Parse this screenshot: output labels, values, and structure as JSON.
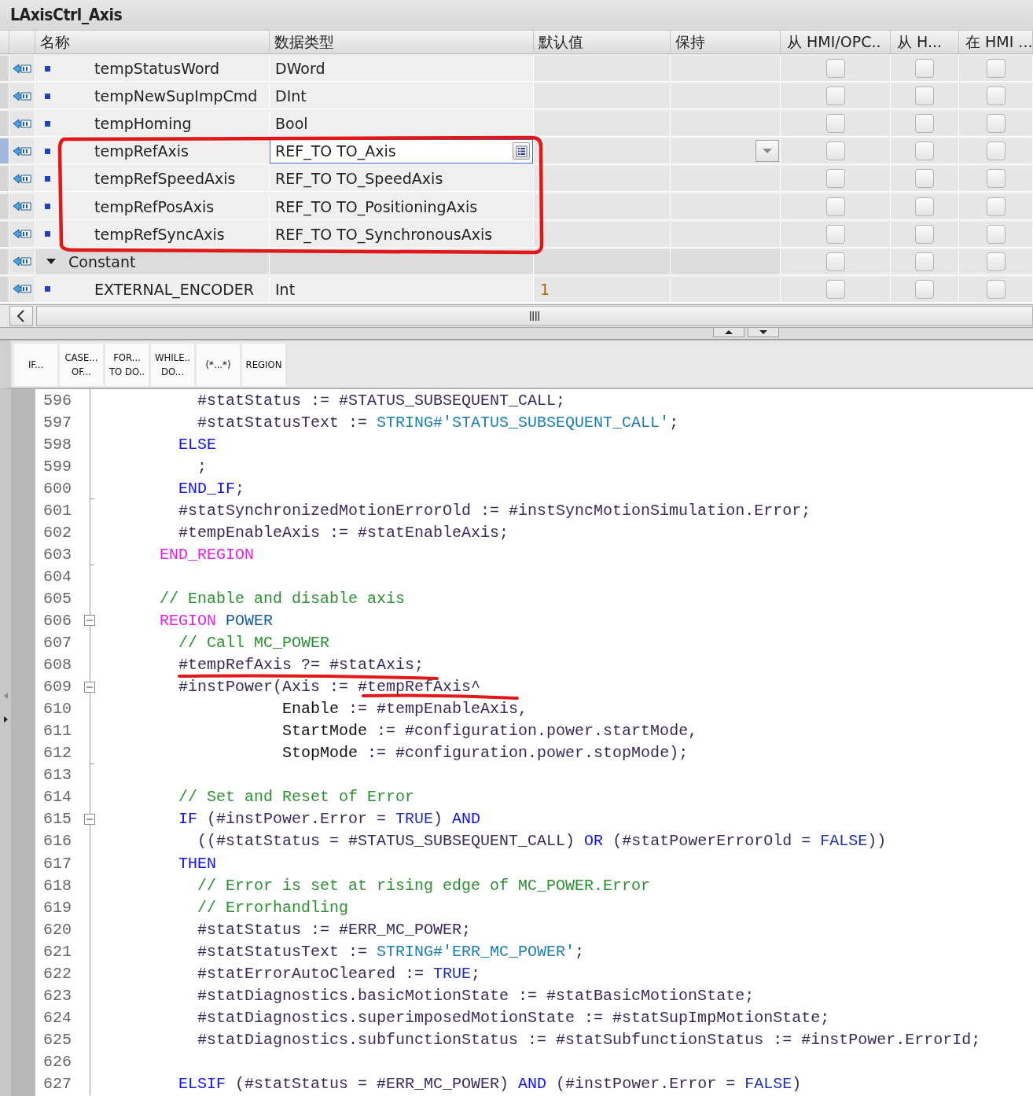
{
  "window": {
    "title": "LAxisCtrl_Axis"
  },
  "table": {
    "columns": [
      "名称",
      "数据类型",
      "默认值",
      "保持",
      "从 HMI/OPC..",
      "从 H...",
      "在 HMI ..."
    ],
    "rows": [
      {
        "kind": "variable",
        "name": "tempStatusWord",
        "type": "DWord",
        "selected": false,
        "checks": [
          false,
          false,
          false
        ]
      },
      {
        "kind": "variable",
        "name": "tempNewSupImpCmd",
        "type": "DInt",
        "selected": false,
        "checks": [
          false,
          false,
          false
        ]
      },
      {
        "kind": "variable",
        "name": "tempHoming",
        "type": "Bool",
        "selected": false,
        "checks": [
          false,
          false,
          false
        ]
      },
      {
        "kind": "variable",
        "name": "tempRefAxis",
        "type": "REF_TO TO_Axis",
        "selected": true,
        "checks": [
          false,
          false,
          false
        ]
      },
      {
        "kind": "variable",
        "name": "tempRefSpeedAxis",
        "type": "REF_TO TO_SpeedAxis",
        "selected": false,
        "checks": [
          false,
          false,
          false
        ]
      },
      {
        "kind": "variable",
        "name": "tempRefPosAxis",
        "type": "REF_TO TO_PositioningAxis",
        "selected": false,
        "checks": [
          false,
          false,
          false
        ]
      },
      {
        "kind": "variable",
        "name": "tempRefSyncAxis",
        "type": "REF_TO TO_SynchronousAxis",
        "selected": false,
        "checks": [
          false,
          false,
          false
        ]
      },
      {
        "kind": "section",
        "name": "Constant",
        "expanded": true,
        "selected": false,
        "checks": [
          false,
          false,
          false
        ],
        "children": [
          {
            "kind": "variable",
            "name": "EXTERNAL_ENCODER",
            "type": "Int",
            "default": "1",
            "selected": false,
            "checks": [
              false,
              false,
              false
            ]
          }
        ]
      }
    ]
  },
  "toolbar": [
    "IF...",
    "CASE...\nOF...",
    "FOR...\nTO DO..",
    "WHILE..\nDO...",
    "(*...*)",
    "REGION"
  ],
  "code": [
    {
      "n": "596",
      "tokens": [
        {
          "kind": "var",
          "text": "          #statStatus := #STATUS_SUBSEQUENT_CALL;"
        }
      ]
    },
    {
      "n": "597",
      "tokens": [
        {
          "kind": "var",
          "text": "          #statStatusText := "
        },
        {
          "kind": "string",
          "text": "STRING#'STATUS_SUBSEQUENT_CALL'"
        },
        {
          "kind": "var",
          "text": ";"
        }
      ]
    },
    {
      "n": "598",
      "tokens": [
        {
          "kind": "keyword",
          "text": "        ELSE"
        }
      ]
    },
    {
      "n": "599",
      "tokens": [
        {
          "kind": "var",
          "text": "          ;"
        }
      ]
    },
    {
      "n": "600",
      "fold_end": true,
      "tokens": [
        {
          "kind": "keyword",
          "text": "        END_IF"
        },
        {
          "kind": "var",
          "text": ";"
        }
      ]
    },
    {
      "n": "601",
      "tokens": [
        {
          "kind": "var",
          "text": "        #statSynchronizedMotionErrorOld := #instSyncMotionSimulation.Error;"
        }
      ]
    },
    {
      "n": "602",
      "tokens": [
        {
          "kind": "var",
          "text": "        #tempEnableAxis := #statEnableAxis;"
        }
      ]
    },
    {
      "n": "603",
      "fold_end": true,
      "tokens": [
        {
          "kind": "region",
          "text": "      END_REGION"
        }
      ]
    },
    {
      "n": "604"
    },
    {
      "n": "605",
      "tokens": [
        {
          "kind": "comment",
          "text": "      // Enable and disable axis"
        }
      ]
    },
    {
      "n": "606",
      "fold": true,
      "tokens": [
        {
          "kind": "region",
          "text": "      REGION"
        },
        {
          "kind": "name",
          "text": " POWER"
        }
      ]
    },
    {
      "n": "607",
      "tokens": [
        {
          "kind": "comment",
          "text": "        // Call MC_POWER"
        }
      ]
    },
    {
      "n": "608",
      "tokens": [
        {
          "kind": "var",
          "text": "        #tempRefAxis ?= #statAxis;"
        }
      ]
    },
    {
      "n": "609",
      "fold": true,
      "tokens": [
        {
          "kind": "var",
          "text": "        #instPower(Axis := #tempRefAxis^"
        }
      ]
    },
    {
      "n": "610",
      "tokens": [
        {
          "kind": "plain",
          "text": "                   Enable"
        },
        {
          "kind": "var",
          "text": " := #tempEnableAxis,"
        }
      ]
    },
    {
      "n": "611",
      "tokens": [
        {
          "kind": "plain",
          "text": "                   StartMode"
        },
        {
          "kind": "var",
          "text": " := #configuration.power.startMode,"
        }
      ]
    },
    {
      "n": "612",
      "fold_end": true,
      "tokens": [
        {
          "kind": "plain",
          "text": "                   StopMode"
        },
        {
          "kind": "var",
          "text": " := #configuration.power.stopMode);"
        }
      ]
    },
    {
      "n": "613"
    },
    {
      "n": "614",
      "tokens": [
        {
          "kind": "comment",
          "text": "        // Set and Reset of Error"
        }
      ]
    },
    {
      "n": "615",
      "fold": true,
      "tokens": [
        {
          "kind": "keyword",
          "text": "        IF"
        },
        {
          "kind": "var",
          "text": " (#instPower.Error = "
        },
        {
          "kind": "const",
          "text": "TRUE"
        },
        {
          "kind": "var",
          "text": ") "
        },
        {
          "kind": "keyword",
          "text": "AND"
        }
      ]
    },
    {
      "n": "616",
      "tokens": [
        {
          "kind": "var",
          "text": "          ((#statStatus = #STATUS_SUBSEQUENT_CALL) "
        },
        {
          "kind": "keyword",
          "text": "OR"
        },
        {
          "kind": "var",
          "text": " (#statPowerErrorOld = "
        },
        {
          "kind": "const",
          "text": "FALSE"
        },
        {
          "kind": "var",
          "text": "))"
        }
      ]
    },
    {
      "n": "617",
      "tokens": [
        {
          "kind": "keyword",
          "text": "        THEN"
        }
      ]
    },
    {
      "n": "618",
      "tokens": [
        {
          "kind": "comment",
          "text": "          // Error is set at rising edge of MC_POWER.Error"
        }
      ]
    },
    {
      "n": "619",
      "tokens": [
        {
          "kind": "comment",
          "text": "          // Errorhandling"
        }
      ]
    },
    {
      "n": "620",
      "tokens": [
        {
          "kind": "var",
          "text": "          #statStatus := #ERR_MC_POWER;"
        }
      ]
    },
    {
      "n": "621",
      "tokens": [
        {
          "kind": "var",
          "text": "          #statStatusText := "
        },
        {
          "kind": "string",
          "text": "STRING#'ERR_MC_POWER'"
        },
        {
          "kind": "var",
          "text": ";"
        }
      ]
    },
    {
      "n": "622",
      "tokens": [
        {
          "kind": "var",
          "text": "          #statErrorAutoCleared := "
        },
        {
          "kind": "const",
          "text": "TRUE"
        },
        {
          "kind": "var",
          "text": ";"
        }
      ]
    },
    {
      "n": "623",
      "tokens": [
        {
          "kind": "var",
          "text": "          #statDiagnostics.basicMotionState := #statBasicMotionState;"
        }
      ]
    },
    {
      "n": "624",
      "tokens": [
        {
          "kind": "var",
          "text": "          #statDiagnostics.superimposedMotionState := #statSupImpMotionState;"
        }
      ]
    },
    {
      "n": "625",
      "tokens": [
        {
          "kind": "var",
          "text": "          #statDiagnostics.subfunctionStatus := #statSubfunctionStatus := #instPower.ErrorId;"
        }
      ]
    },
    {
      "n": "626"
    },
    {
      "n": "627",
      "tokens": [
        {
          "kind": "keyword",
          "text": "        ELSIF"
        },
        {
          "kind": "var",
          "text": " (#statStatus = #ERR_MC_POWER) "
        },
        {
          "kind": "keyword",
          "text": "AND"
        },
        {
          "kind": "var",
          "text": " (#instPower.Error = "
        },
        {
          "kind": "const",
          "text": "FALSE"
        },
        {
          "kind": "var",
          "text": ")"
        }
      ]
    }
  ],
  "annotations": [
    {
      "kind": "outline"
    },
    {
      "kind": "underline"
    },
    {
      "kind": "underline"
    }
  ]
}
